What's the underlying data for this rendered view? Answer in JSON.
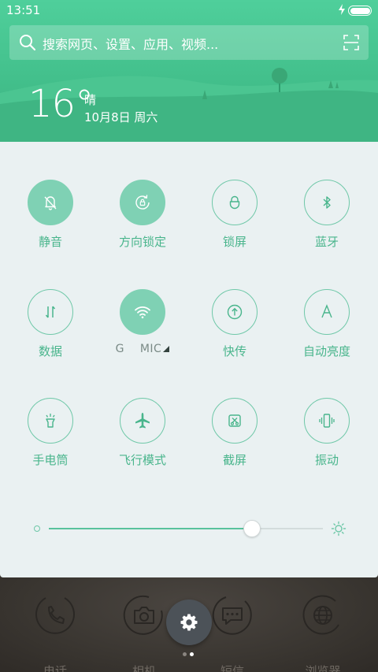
{
  "status_bar": {
    "time": "13:51",
    "battery_level": 1.0
  },
  "search": {
    "placeholder": "搜索网页、设置、应用、视频..."
  },
  "weather": {
    "temperature": "16°",
    "condition": "晴",
    "date": "10月8日 周六"
  },
  "quick_settings": [
    {
      "label": "静音",
      "icon": "bell-off-icon",
      "active": true
    },
    {
      "label": "方向锁定",
      "icon": "rotation-lock-icon",
      "active": true
    },
    {
      "label": "锁屏",
      "icon": "lock-icon",
      "active": false
    },
    {
      "label": "蓝牙",
      "icon": "bluetooth-icon",
      "active": false
    },
    {
      "label": "数据",
      "icon": "mobile-data-icon",
      "active": false
    },
    {
      "label": "G    MIC",
      "icon": "wifi-icon",
      "active": true
    },
    {
      "label": "快传",
      "icon": "transfer-icon",
      "active": false
    },
    {
      "label": "自动亮度",
      "icon": "auto-brightness-icon",
      "active": false
    },
    {
      "label": "手电筒",
      "icon": "flashlight-icon",
      "active": false
    },
    {
      "label": "飞行模式",
      "icon": "airplane-icon",
      "active": false
    },
    {
      "label": "截屏",
      "icon": "screenshot-icon",
      "active": false
    },
    {
      "label": "振动",
      "icon": "vibrate-icon",
      "active": false
    }
  ],
  "brightness": {
    "level": 0.74
  },
  "dock": {
    "apps": [
      {
        "label": "电话",
        "icon": "phone-icon"
      },
      {
        "label": "相机",
        "icon": "camera-icon"
      },
      {
        "label": "短信",
        "icon": "sms-icon"
      },
      {
        "label": "浏览器",
        "icon": "browser-icon"
      }
    ],
    "page_count": 2,
    "active_page": 1
  },
  "colors": {
    "accent": "#49b58c",
    "tile_active": "#7fd1b4",
    "header": "#43c08c",
    "panel": "#eaf1f2",
    "fab": "#4c5258"
  }
}
